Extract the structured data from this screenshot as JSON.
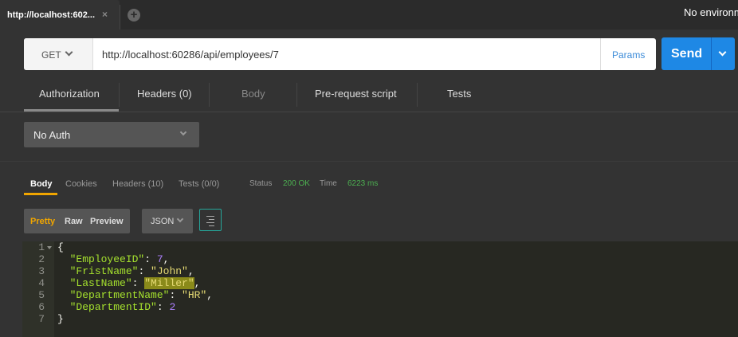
{
  "tab": {
    "title": "http://localhost:602...",
    "close": "×"
  },
  "add_tab": "+",
  "environment": "No environm",
  "request": {
    "method": "GET",
    "url": "http://localhost:60286/api/employees/7",
    "params_label": "Params",
    "send_label": "Send"
  },
  "request_tabs": [
    "Authorization",
    "Headers (0)",
    "Body",
    "Pre-request script",
    "Tests"
  ],
  "auth": {
    "selected": "No Auth"
  },
  "response_tabs": {
    "body": "Body",
    "cookies": "Cookies",
    "headers": "Headers (10)",
    "tests": "Tests (0/0)"
  },
  "status": {
    "status_label": "Status",
    "status_value": "200 OK",
    "time_label": "Time",
    "time_value": "6223 ms"
  },
  "format": {
    "pretty": "Pretty",
    "raw": "Raw",
    "preview": "Preview",
    "type": "JSON"
  },
  "response_json": {
    "open": "{",
    "close": "}",
    "fields": [
      {
        "key": "\"EmployeeID\"",
        "value": "7",
        "kind": "number"
      },
      {
        "key": "\"FristName\"",
        "value": "\"John\"",
        "kind": "string"
      },
      {
        "key": "\"LastName\"",
        "value": "\"Miller\"",
        "kind": "string",
        "highlighted": true
      },
      {
        "key": "\"DepartmentName\"",
        "value": "\"HR\"",
        "kind": "string"
      },
      {
        "key": "\"DepartmentID\"",
        "value": "2",
        "kind": "number"
      }
    ]
  },
  "line_numbers": [
    "1",
    "2",
    "3",
    "4",
    "5",
    "6",
    "7"
  ],
  "colors": {
    "send": "#1e88e5",
    "accent": "#f0a500",
    "status_ok": "#4caf50"
  },
  "icons": [
    "close-icon",
    "plus-icon",
    "chevron-down-icon",
    "wrap-lines-icon",
    "fold-arrow-icon"
  ]
}
